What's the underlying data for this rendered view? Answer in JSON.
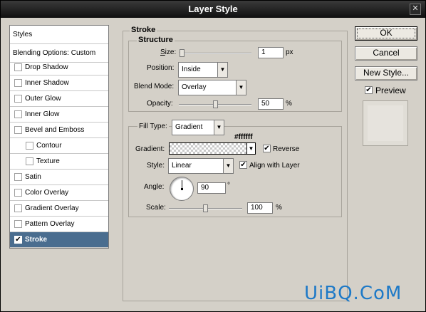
{
  "window": {
    "title": "Layer Style",
    "close_glyph": "✕"
  },
  "left_panel": {
    "header": "Styles",
    "blending": "Blending Options: Custom",
    "items": [
      {
        "label": "Drop Shadow",
        "checked": false,
        "indent": false,
        "selected": false
      },
      {
        "label": "Inner Shadow",
        "checked": false,
        "indent": false,
        "selected": false
      },
      {
        "label": "Outer Glow",
        "checked": false,
        "indent": false,
        "selected": false
      },
      {
        "label": "Inner Glow",
        "checked": false,
        "indent": false,
        "selected": false
      },
      {
        "label": "Bevel and Emboss",
        "checked": false,
        "indent": false,
        "selected": false
      },
      {
        "label": "Contour",
        "checked": false,
        "indent": true,
        "selected": false
      },
      {
        "label": "Texture",
        "checked": false,
        "indent": true,
        "selected": false
      },
      {
        "label": "Satin",
        "checked": false,
        "indent": false,
        "selected": false
      },
      {
        "label": "Color Overlay",
        "checked": false,
        "indent": false,
        "selected": false
      },
      {
        "label": "Gradient Overlay",
        "checked": false,
        "indent": false,
        "selected": false
      },
      {
        "label": "Pattern Overlay",
        "checked": false,
        "indent": false,
        "selected": false
      },
      {
        "label": "Stroke",
        "checked": true,
        "indent": false,
        "selected": true
      }
    ]
  },
  "stroke": {
    "title": "Stroke",
    "structure_title": "Structure",
    "size_label": "Size:",
    "size_value": "1",
    "size_unit": "px",
    "position_label": "Position:",
    "position_value": "Inside",
    "blend_label": "Blend Mode:",
    "blend_value": "Overlay",
    "opacity_label": "Opacity:",
    "opacity_value": "50",
    "opacity_unit": "%",
    "fill_type_label": "Fill Type:",
    "fill_type_value": "Gradient",
    "gradient_color_note": "#ffffff",
    "gradient_label": "Gradient:",
    "reverse_label": "Reverse",
    "reverse_checked": true,
    "style_label": "Style:",
    "style_value": "Linear",
    "align_label": "Align with Layer",
    "align_checked": true,
    "angle_label": "Angle:",
    "angle_value": "90",
    "angle_unit": "°",
    "scale_label": "Scale:",
    "scale_value": "100",
    "scale_unit": "%",
    "size_slider_fraction": 0.01,
    "opacity_slider_fraction": 0.5,
    "scale_slider_fraction": 0.5
  },
  "buttons": {
    "ok": "OK",
    "cancel": "Cancel",
    "new_style": "New Style...",
    "preview_label": "Preview",
    "preview_checked": true
  },
  "watermark": "UiBQ.CoM",
  "check_glyph": "✔",
  "arrow_glyph": "▼",
  "colors": {
    "selected_bg": "#4a6d8f",
    "title_bg": "#1a1a1a",
    "watermark": "#1d79c7"
  }
}
